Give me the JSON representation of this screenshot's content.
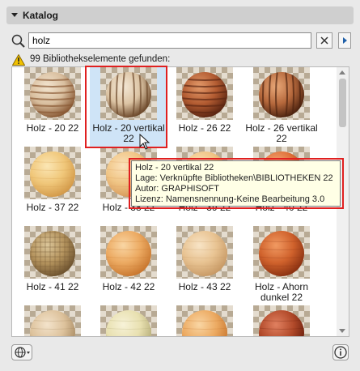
{
  "panel": {
    "title": "Katalog"
  },
  "search": {
    "value": "holz"
  },
  "status": {
    "found_text": "99 Bibliothekselemente gefunden:"
  },
  "items": [
    {
      "label": "Holz - 20 22",
      "material": "striped-light",
      "selected": false
    },
    {
      "label": "Holz - 20 vertikal 22",
      "material": "vertical-light",
      "selected": true
    },
    {
      "label": "Holz - 26 22",
      "material": "striped-dark",
      "selected": false
    },
    {
      "label": "Holz - 26 vertikal 22",
      "material": "vertical-dark",
      "selected": false
    },
    {
      "label": "Holz - 37 22",
      "material": "pale-yellow",
      "selected": false
    },
    {
      "label": "Holz - 38 22",
      "material": "pale-orange",
      "selected": false
    },
    {
      "label": "Holz - 39 22",
      "material": "pale-orange",
      "selected": false
    },
    {
      "label": "Holz - 40 22",
      "material": "red-orange",
      "selected": false
    },
    {
      "label": "Holz - 41 22",
      "material": "check-brown",
      "selected": false
    },
    {
      "label": "Holz - 42 22",
      "material": "orange",
      "selected": false
    },
    {
      "label": "Holz - 43 22",
      "material": "pale-beige",
      "selected": false
    },
    {
      "label": "Holz - Ahorn\ndunkel 22",
      "material": "red-brown",
      "selected": false
    },
    {
      "label": "",
      "material": "fine-beige",
      "selected": false
    },
    {
      "label": "",
      "material": "pale-green",
      "selected": false
    },
    {
      "label": "",
      "material": "orange",
      "selected": false
    },
    {
      "label": "",
      "material": "dark-red",
      "selected": false
    }
  ],
  "tooltip": {
    "line1": "Holz - 20 vertikal 22",
    "line2": "Lage: Verknüpfte Bibliotheken\\BIBLIOTHEKEN 22",
    "line3": "Autor: GRAPHISOFT",
    "line4": "Lizenz: Namensnennung-Keine Bearbeitung 3.0"
  },
  "icons": {
    "search": "magnifier-icon",
    "clear": "close-icon",
    "play": "play-icon",
    "warning": "warning-icon",
    "globe": "globe-icon",
    "info": "info-icon"
  },
  "colors": {
    "highlight": "#e02020",
    "selection": "#cfe4f7",
    "accent": "#1f5fa8"
  }
}
